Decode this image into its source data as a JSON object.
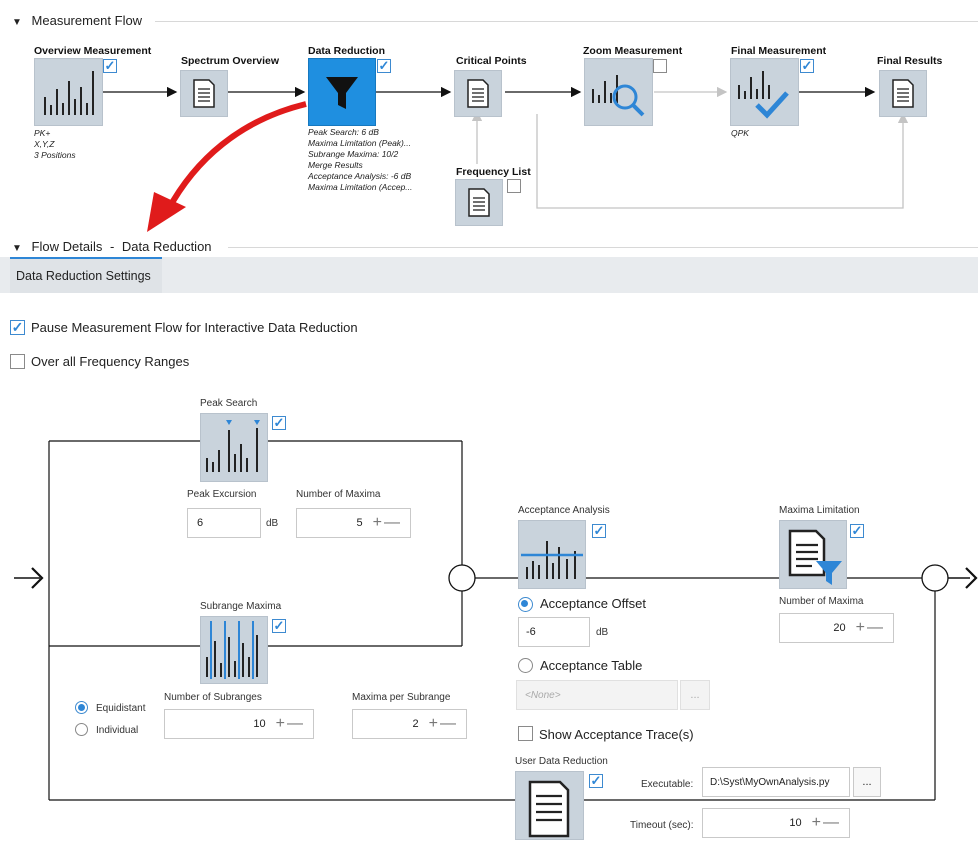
{
  "flow": {
    "header": "Measurement Flow",
    "nodes": {
      "overview": {
        "title": "Overview Measurement",
        "notes": [
          "PK+",
          "X,Y,Z",
          "3 Positions"
        ],
        "checked": true
      },
      "spectrum": {
        "title": "Spectrum Overview"
      },
      "reduction": {
        "title": "Data Reduction",
        "checked": true,
        "notes": [
          "Peak Search: 6 dB",
          "Maxima Limitation (Peak)...",
          "Subrange Maxima: 10/2",
          "Merge Results",
          "Acceptance Analysis: -6 dB",
          "Maxima Limitation (Accep..."
        ]
      },
      "critical": {
        "title": "Critical Points"
      },
      "zoom": {
        "title": "Zoom Measurement",
        "checked": false
      },
      "final": {
        "title": "Final Measurement",
        "checked": true,
        "notes": [
          "QPK"
        ]
      },
      "results": {
        "title": "Final Results"
      },
      "freqlist": {
        "title": "Frequency List",
        "checked": false
      }
    }
  },
  "details": {
    "header_prefix": "Flow Details",
    "header_sep": "-",
    "header_item": "Data Reduction",
    "tab_label": "Data Reduction Settings",
    "pause_label": "Pause Measurement Flow for Interactive Data Reduction",
    "pause_checked": true,
    "over_all_label": "Over all Frequency Ranges",
    "over_all_checked": false
  },
  "peak": {
    "title": "Peak Search",
    "excursion_label": "Peak Excursion",
    "excursion_value": "6",
    "excursion_unit": "dB",
    "maxima_label": "Number of Maxima",
    "maxima_value": "5"
  },
  "subrange": {
    "title": "Subrange Maxima",
    "equidistant_label": "Equidistant",
    "individual_label": "Individual",
    "num_subranges_label": "Number of Subranges",
    "num_subranges_value": "10",
    "maxima_per_label": "Maxima per Subrange",
    "maxima_per_value": "2"
  },
  "acceptance": {
    "title": "Acceptance Analysis",
    "offset_label": "Acceptance Offset",
    "offset_value": "-6",
    "offset_unit": "dB",
    "table_label": "Acceptance Table",
    "table_value": "<None>",
    "browse_label": "...",
    "show_trace_label": "Show Acceptance Trace(s)"
  },
  "maxlimit": {
    "title": "Maxima Limitation",
    "num_label": "Number of Maxima",
    "num_value": "20"
  },
  "user": {
    "title": "User Data Reduction",
    "exec_label": "Executable:",
    "exec_value": "D:\\Syst\\MyOwnAnalysis.py",
    "browse_label": "...",
    "timeout_label": "Timeout (sec):",
    "timeout_value": "10"
  },
  "spin_symbols": "+—",
  "colors": {
    "accent": "#2e86d6",
    "active_node": "#1f8fe0",
    "arrow": "#e01b1b"
  }
}
